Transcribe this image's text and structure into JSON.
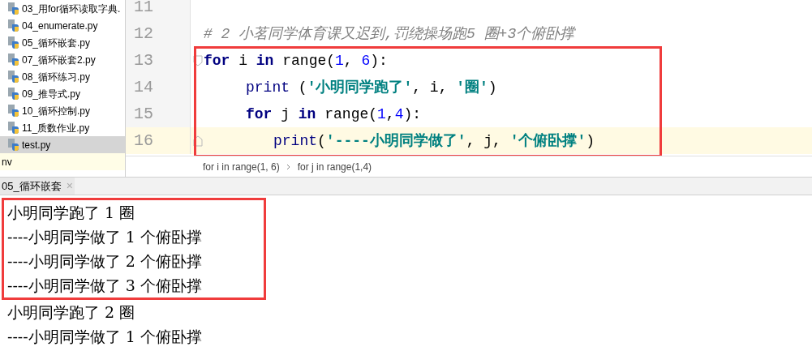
{
  "sidebar": {
    "items": [
      {
        "label": "03_用for循环读取字典.",
        "kind": "file",
        "selected": false
      },
      {
        "label": "04_enumerate.py",
        "kind": "file",
        "selected": false
      },
      {
        "label": "05_循环嵌套.py",
        "kind": "file",
        "selected": false
      },
      {
        "label": "07_循环嵌套2.py",
        "kind": "file",
        "selected": false
      },
      {
        "label": "08_循环练习.py",
        "kind": "file",
        "selected": false
      },
      {
        "label": "09_推导式.py",
        "kind": "file",
        "selected": false
      },
      {
        "label": "10_循环控制.py",
        "kind": "file",
        "selected": false
      },
      {
        "label": "11_质数作业.py",
        "kind": "file",
        "selected": false
      },
      {
        "label": "test.py",
        "kind": "file",
        "selected": true
      },
      {
        "label": "nv",
        "kind": "folder",
        "selected": false
      }
    ]
  },
  "editor": {
    "lines": [
      {
        "number": "11",
        "current": false,
        "highlighted": false,
        "fold": false
      },
      {
        "number": "12",
        "current": false,
        "highlighted": false,
        "fold": false,
        "tokens": [
          {
            "text": "# 2 小茗同学体育课又迟到,罚绕操场跑5 圈+3个俯卧撑",
            "kind": "comment"
          }
        ]
      },
      {
        "number": "13",
        "current": false,
        "highlighted": true,
        "fold": true,
        "tokens": [
          {
            "text": "for",
            "kind": "keyword"
          },
          {
            "text": " i ",
            "kind": "plain"
          },
          {
            "text": "in",
            "kind": "keyword"
          },
          {
            "text": " range(",
            "kind": "plain"
          },
          {
            "text": "1",
            "kind": "number"
          },
          {
            "text": ", ",
            "kind": "plain"
          },
          {
            "text": "6",
            "kind": "number"
          },
          {
            "text": "):",
            "kind": "plain"
          }
        ],
        "children": [
          {
            "number": "14",
            "current": false,
            "highlighted": true,
            "fold": false,
            "tokens": [
              {
                "text": "print",
                "kind": "builtin"
              },
              {
                "text": " (",
                "kind": "plain"
              },
              {
                "text": "'小明同学跑了'",
                "kind": "string"
              },
              {
                "text": ", i, ",
                "kind": "plain"
              },
              {
                "text": "'圈'",
                "kind": "string"
              },
              {
                "text": ")",
                "kind": "plain"
              }
            ]
          },
          {
            "number": "15",
            "current": false,
            "highlighted": true,
            "fold": false,
            "tokens": [
              {
                "text": "for",
                "kind": "keyword"
              },
              {
                "text": " j ",
                "kind": "plain"
              },
              {
                "text": "in",
                "kind": "keyword"
              },
              {
                "text": " range(",
                "kind": "plain"
              },
              {
                "text": "1",
                "kind": "number"
              },
              {
                "text": ",",
                "kind": "plain"
              },
              {
                "text": "4",
                "kind": "number"
              },
              {
                "text": "):",
                "kind": "plain"
              }
            ],
            "children": [
              {
                "number": "16",
                "current": true,
                "highlighted": true,
                "fold": true,
                "tokens": [
                  {
                    "text": "print",
                    "kind": "builtin"
                  },
                  {
                    "text": "(",
                    "kind": "plain"
                  },
                  {
                    "text": "'----小明同学做了'",
                    "kind": "string"
                  },
                  {
                    "text": ", j, ",
                    "kind": "plain"
                  },
                  {
                    "text": "'个俯卧撑'",
                    "kind": "string"
                  },
                  {
                    "text": ")",
                    "kind": "plain"
                  }
                ]
              }
            ]
          }
        ]
      }
    ],
    "breadcrumbs": [
      "for i in range(1, 6)",
      "for j in range(1,4)"
    ]
  },
  "run_tab": {
    "label": "05_循环嵌套",
    "close": "×"
  },
  "output": {
    "lines": [
      {
        "text": "小明同学跑了 1 圈",
        "highlighted": true
      },
      {
        "text": "----小明同学做了 1 个俯卧撑",
        "highlighted": true
      },
      {
        "text": "----小明同学做了 2 个俯卧撑",
        "highlighted": true
      },
      {
        "text": "----小明同学做了 3 个俯卧撑",
        "highlighted": true
      },
      {
        "text": "小明同学跑了 2 圈",
        "highlighted": false
      },
      {
        "text": "----小明同学做了 1 个俯卧撑",
        "highlighted": false
      }
    ]
  }
}
